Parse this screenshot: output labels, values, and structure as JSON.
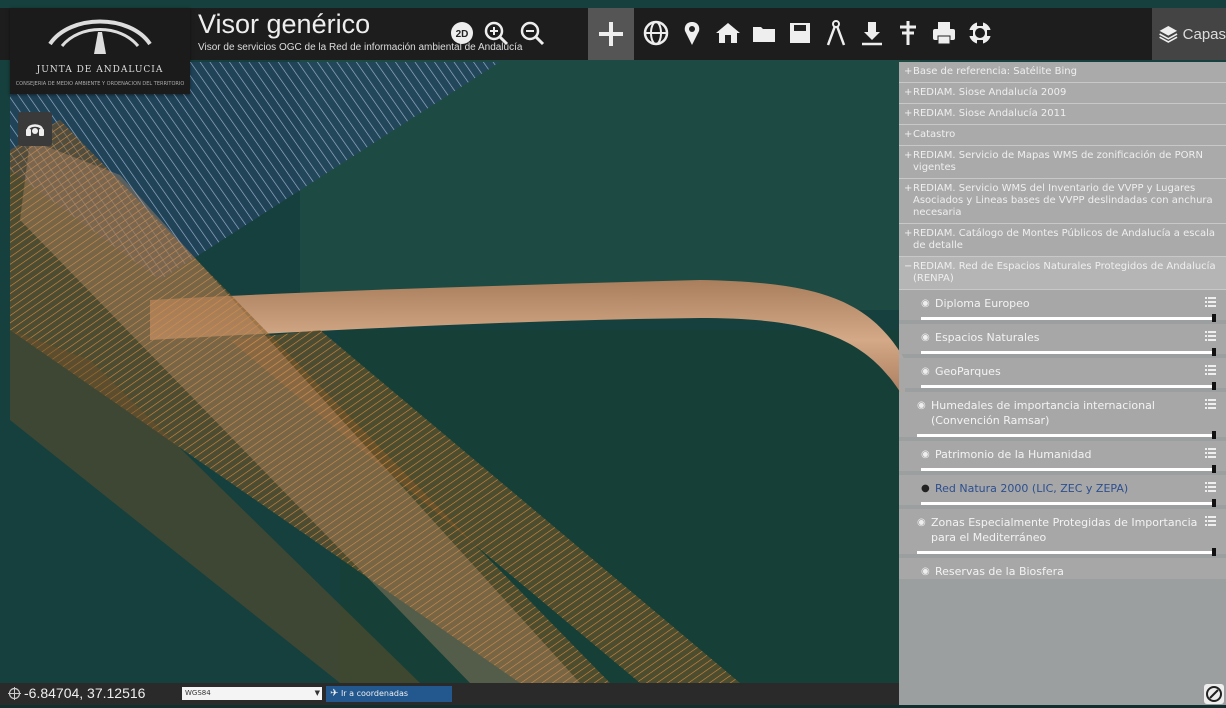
{
  "app": {
    "logo_name": "JUNTA DE ANDALUCIA",
    "logo_subtitle": "CONSEJERÍA DE MEDIO AMBIENTE Y ORDENACIÓN DEL TERRITORIO",
    "title": "Visor genérico",
    "subtitle": "Visor de servicios OGC de la Red de información ambiental de Andalucía"
  },
  "toolbar": {
    "badge_3d": "2D",
    "capas_label": "Capas",
    "tools": [
      {
        "name": "view-2d-3d-icon"
      },
      {
        "name": "zoom-in-icon"
      },
      {
        "name": "zoom-out-icon"
      },
      {
        "name": "pan-icon",
        "active": true
      },
      {
        "name": "globe-icon"
      },
      {
        "name": "map-marker-icon"
      },
      {
        "name": "home-icon"
      },
      {
        "name": "folder-icon"
      },
      {
        "name": "save-icon"
      },
      {
        "name": "measure-icon"
      },
      {
        "name": "download-icon"
      },
      {
        "name": "pole-icon"
      },
      {
        "name": "print-icon"
      },
      {
        "name": "help-icon"
      },
      {
        "name": "layers-icon"
      }
    ]
  },
  "layers": [
    {
      "label": "Base de referencia: Satélite Bing",
      "expander": "+"
    },
    {
      "label": "REDIAM. Siose Andalucía 2009",
      "expander": "+"
    },
    {
      "label": "REDIAM. Siose Andalucía 2011",
      "expander": "+"
    },
    {
      "label": "Catastro",
      "expander": "+"
    },
    {
      "label": "REDIAM. Servicio de Mapas WMS de zonificación de PORN vigentes",
      "expander": "+"
    },
    {
      "label": "REDIAM. Servicio WMS del Inventario de VVPP y Lugares Asociados y Lineas bases de VVPP deslindadas con anchura necesaria",
      "expander": "+"
    },
    {
      "label": "REDIAM. Catálogo de Montes Públicos de Andalucía a escala de detalle",
      "expander": "+"
    },
    {
      "label": "REDIAM. Red de Espacios Naturales Protegidos de Andalucía (RENPA)",
      "expander": "−"
    }
  ],
  "sublayers": [
    {
      "label": "Diploma Europeo",
      "selected": false
    },
    {
      "label": "Espacios Naturales",
      "selected": false
    },
    {
      "label": "GeoParques",
      "selected": false
    },
    {
      "label": "Humedales de importancia internacional (Convención Ramsar)",
      "selected": false
    },
    {
      "label": "Patrimonio de la Humanidad",
      "selected": false
    },
    {
      "label": "Red Natura 2000 (LIC, ZEC y ZEPA)",
      "selected": true
    },
    {
      "label": "Zonas Especialmente Protegidas de Importancia para el Mediterráneo",
      "selected": false
    },
    {
      "label": "Reservas de la Biosfera",
      "selected": false
    }
  ],
  "statusbar": {
    "coordinates": "-6.84704, 37.12516",
    "crs_value": "WGS84",
    "goto_label": "Ir a coordenadas"
  }
}
